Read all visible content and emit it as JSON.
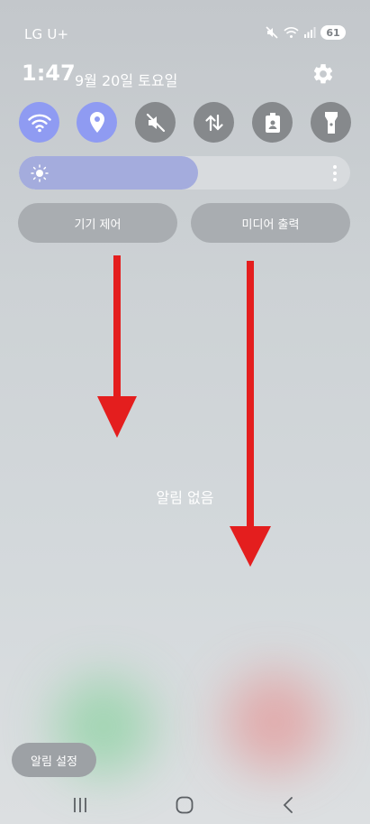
{
  "status_bar": {
    "carrier": "LG U+",
    "battery_level": "61"
  },
  "header": {
    "time": "1:47",
    "date": "9월 20일 토요일"
  },
  "quick_settings": [
    {
      "name": "wifi",
      "state": "on"
    },
    {
      "name": "location",
      "state": "on"
    },
    {
      "name": "sound-mute",
      "state": "off"
    },
    {
      "name": "mobile-data",
      "state": "off"
    },
    {
      "name": "power-saving",
      "state": "off"
    },
    {
      "name": "flashlight",
      "state": "off"
    }
  ],
  "brightness": {
    "level": 0.54
  },
  "buttons": {
    "device_control": "기기 제어",
    "media_output": "미디어 출력"
  },
  "notifications": {
    "empty_text": "알림 없음",
    "settings_label": "알림 설정"
  },
  "colors": {
    "accent": "#8f9bf2",
    "annotation_arrow": "#e41e1e"
  },
  "icons": {
    "nav_recents": "recents-icon",
    "nav_home": "home-icon",
    "nav_back": "back-icon"
  }
}
